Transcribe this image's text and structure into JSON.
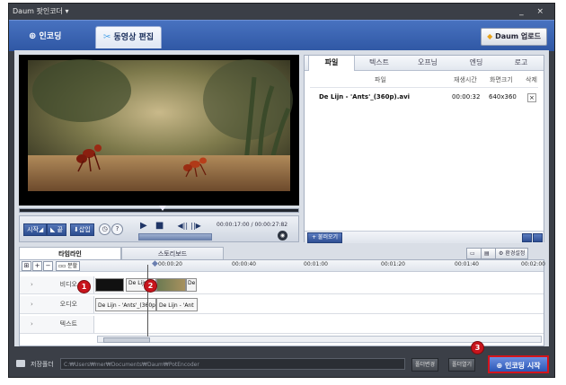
{
  "window": {
    "title": "Daum 팟인코더 ▾",
    "controls": "_ ×"
  },
  "main_tabs": [
    {
      "label": "인코딩"
    },
    {
      "label": "동영상 편집"
    }
  ],
  "upload_button": "Daum 업로드",
  "player": {
    "buttons": {
      "start": "시작◢",
      "end": "◣ 끝",
      "insert": "⬇삽입",
      "help": "?"
    },
    "time_current": "00:00:17:00",
    "time_total": "00:00:27:82"
  },
  "file_panel": {
    "tabs": [
      "파일",
      "텍스트",
      "오프닝",
      "엔딩",
      "로고"
    ],
    "columns": [
      "파일",
      "재생시간",
      "화면크기",
      "삭제"
    ],
    "rows": [
      {
        "file": "De Lijn - 'Ants'_(360p).avi",
        "duration": "00:00:32",
        "size": "640x360",
        "delete": "×"
      }
    ],
    "add_button": "+ 불러오기"
  },
  "timeline": {
    "tabs": [
      "타임라인",
      "스토리보드"
    ],
    "env_button": "환경설정",
    "toolbar": {
      "split": "분할"
    },
    "ticks": [
      "00:00:20",
      "00:00:40",
      "00:01:00",
      "00:01:20",
      "00:01:40",
      "00:02:00"
    ],
    "tracks": [
      {
        "label": "비디오",
        "clips": [
          "De Lijn",
          "De"
        ]
      },
      {
        "label": "오디오",
        "clips": [
          "De Lijn - 'Ants'_(360p",
          "De Lijn - 'Ant"
        ]
      },
      {
        "label": "텍스트",
        "clips": []
      }
    ]
  },
  "markers": [
    "1",
    "2",
    "3"
  ],
  "status": {
    "save_label": "저장폴더",
    "save_path": "C:₩Users₩mer₩Documents₩Daum₩PotEncoder",
    "change_button": "폴더변경",
    "open_button": "폴더열기",
    "encode_button": "인코딩 시작"
  },
  "colors": {
    "accent_blue": "#2f57a4",
    "marker_red": "#c8141c"
  }
}
